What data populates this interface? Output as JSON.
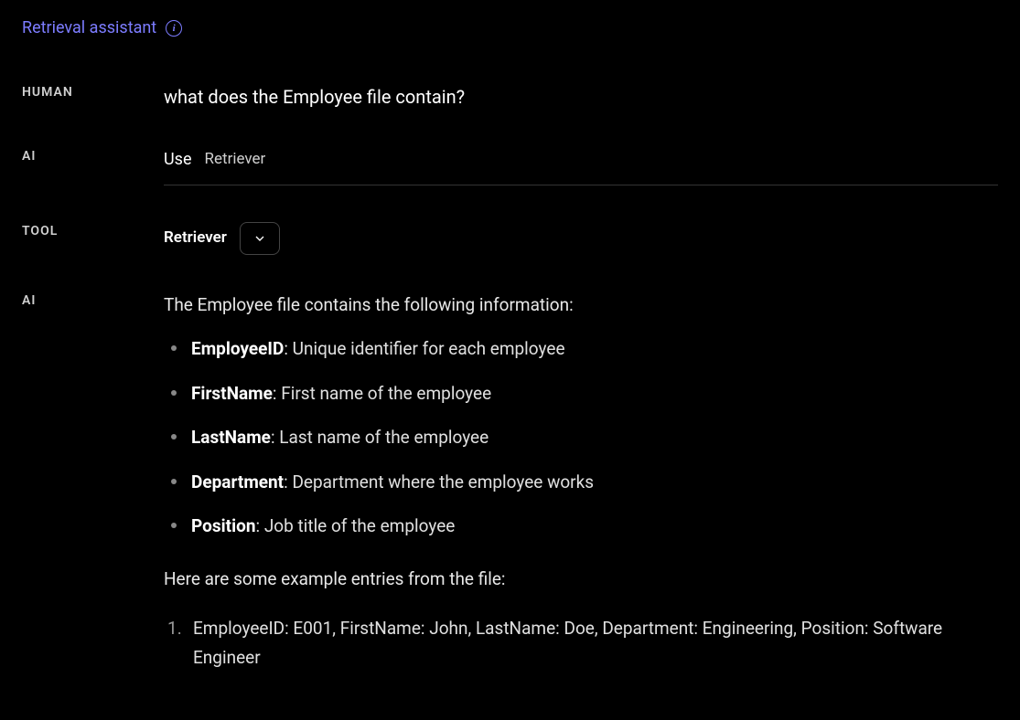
{
  "header": {
    "title": "Retrieval assistant",
    "info_icon": "i"
  },
  "conversation": [
    {
      "role": "HUMAN",
      "message": "what does the Employee file contain?"
    },
    {
      "role": "AI",
      "use_label": "Use",
      "tool_name": "Retriever"
    },
    {
      "role": "TOOL",
      "tool_name": "Retriever"
    },
    {
      "role": "AI",
      "intro": "The Employee file contains the following information:",
      "fields": [
        {
          "name": "EmployeeID",
          "desc": "Unique identifier for each employee"
        },
        {
          "name": "FirstName",
          "desc": "First name of the employee"
        },
        {
          "name": "LastName",
          "desc": "Last name of the employee"
        },
        {
          "name": "Department",
          "desc": "Department where the employee works"
        },
        {
          "name": "Position",
          "desc": "Job title of the employee"
        }
      ],
      "examples_intro": "Here are some example entries from the file:",
      "examples": [
        "EmployeeID: E001, FirstName: John, LastName: Doe, Department: Engineering, Position: Software Engineer"
      ]
    }
  ]
}
